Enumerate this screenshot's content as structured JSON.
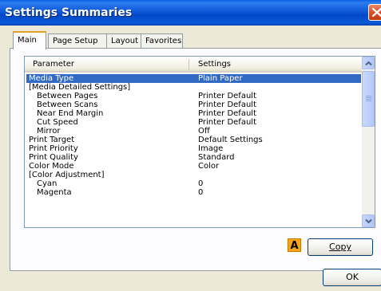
{
  "window": {
    "title": "Settings Summaries"
  },
  "tabs": [
    {
      "label": "Main",
      "active": true
    },
    {
      "label": "Page Setup",
      "active": false
    },
    {
      "label": "Layout",
      "active": false
    },
    {
      "label": "Favorites",
      "active": false
    }
  ],
  "table": {
    "columns": [
      "Parameter",
      "Settings"
    ],
    "rows": [
      {
        "param": "Media Type",
        "value": "Plain Paper",
        "selected": true
      },
      {
        "param": "[Media Detailed Settings]",
        "value": ""
      },
      {
        "param": "Between Pages",
        "value": "Printer Default"
      },
      {
        "param": "Between Scans",
        "value": "Printer Default"
      },
      {
        "param": "Near End Margin",
        "value": "Printer Default"
      },
      {
        "param": "Cut Speed",
        "value": "Printer Default"
      },
      {
        "param": "Mirror",
        "value": "Off"
      },
      {
        "param": "Print Target",
        "value": "Default Settings"
      },
      {
        "param": "Print Priority",
        "value": "Image"
      },
      {
        "param": "Print Quality",
        "value": "Standard"
      },
      {
        "param": "Color Mode",
        "value": "Color"
      },
      {
        "param": "[Color Adjustment]",
        "value": ""
      },
      {
        "param": "Cyan",
        "value": "0"
      },
      {
        "param": "Magenta",
        "value": "0"
      }
    ]
  },
  "badge": {
    "label": "A",
    "color": "#f6a51c"
  },
  "buttons": {
    "copy": "Copy",
    "ok": "OK"
  },
  "icons": {
    "close": "close-icon",
    "scroll_up": "chevron-up-icon",
    "scroll_down": "chevron-down-icon"
  },
  "colors": {
    "selection": "#316ac5",
    "titlebar": "#0058e6",
    "close": "#d4532a"
  }
}
